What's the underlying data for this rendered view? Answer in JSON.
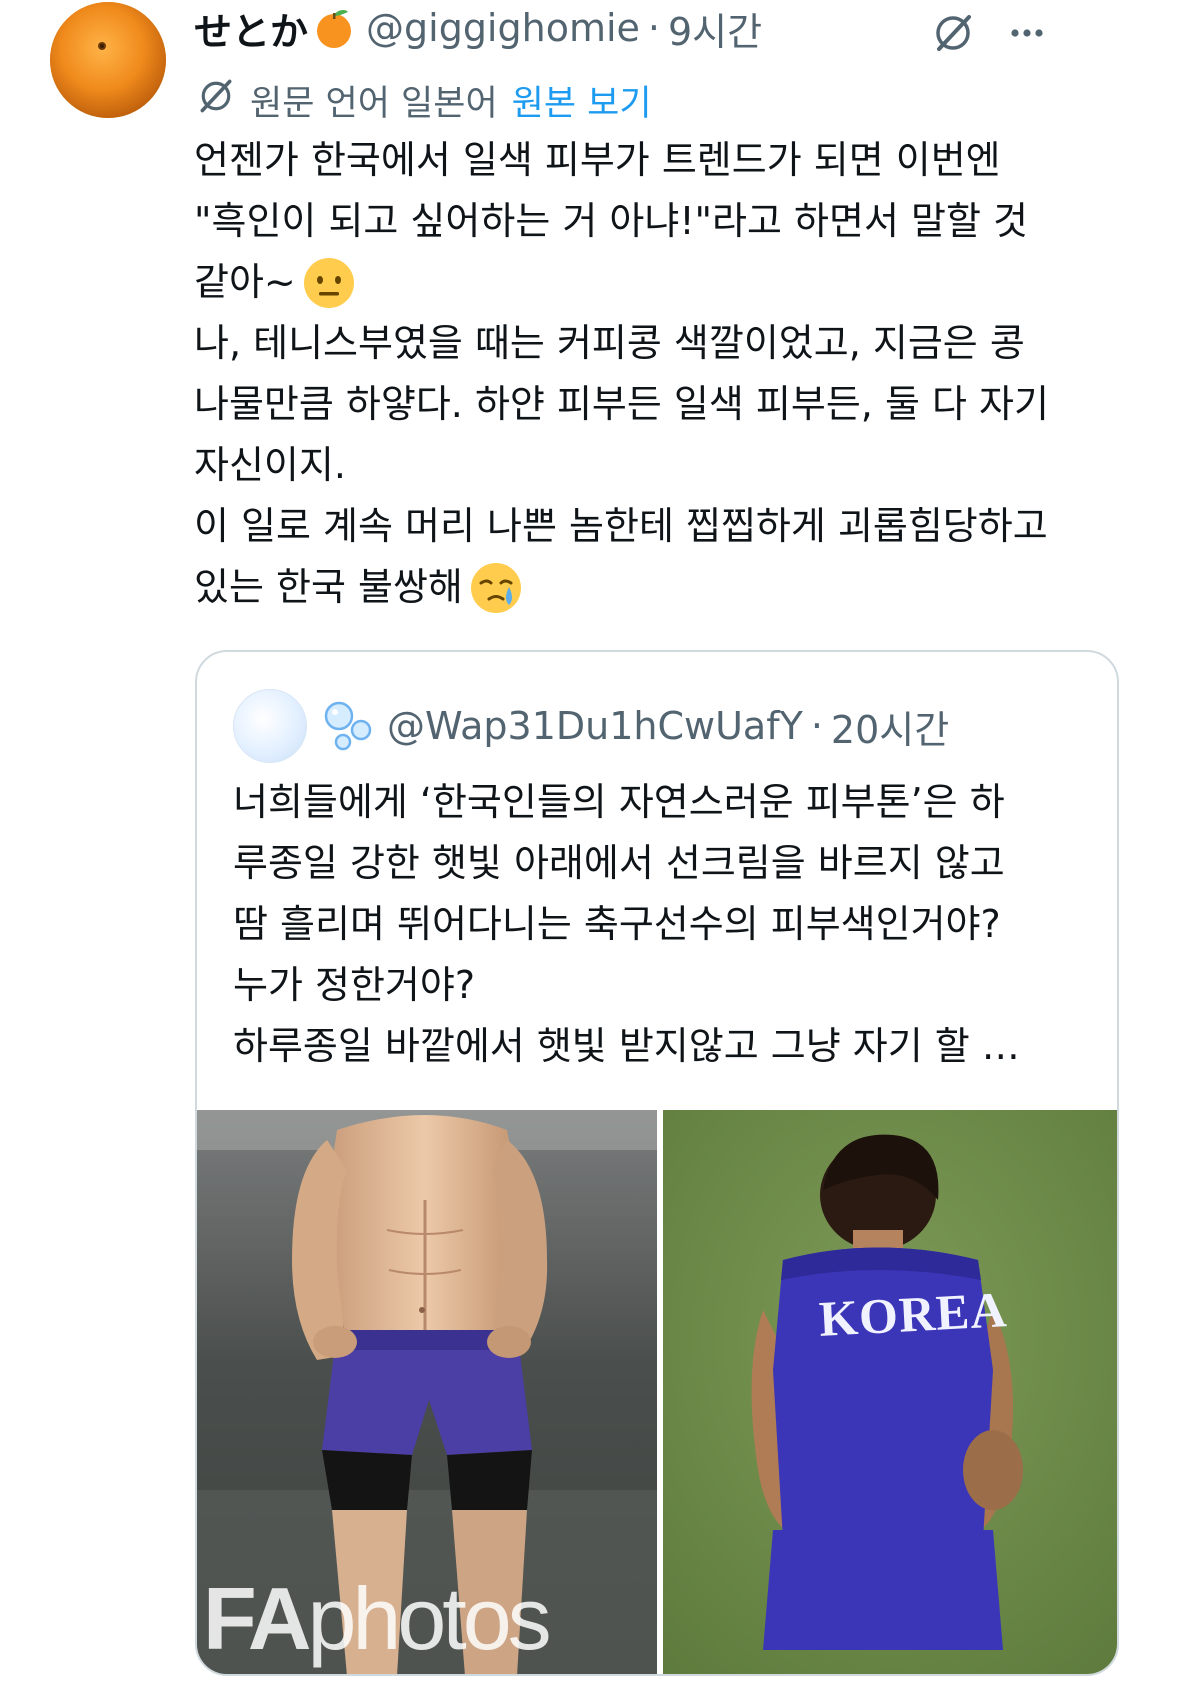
{
  "tweet": {
    "author": {
      "display_name": "せとか",
      "name_emoji": "tangerine-emoji",
      "handle": "@giggighomie",
      "time": "9시간",
      "avatar": "tangerine-photo"
    },
    "header_icons": [
      "grok-icon",
      "more-icon"
    ],
    "translation": {
      "icon": "grok-icon",
      "note": "원문 언어 일본어",
      "show_original_label": "원본 보기"
    },
    "body_lines": [
      "언젠가 한국에서 일색 피부가 트렌드가 되면 이번엔",
      "\"흑인이 되고 싶어하는 거 아냐!\"라고 하면서 말할 것",
      "같아~",
      "나, 테니스부였을 때는 커피콩 색깔이었고, 지금은 콩",
      "나물만큼 하얗다. 하얀 피부든 일색 피부든, 둘 다 자기",
      "자신이지.",
      "이 일로 계속 머리 나쁜 놈한테 찝찝하게 괴롭힘당하고",
      "있는 한국 불쌍해"
    ],
    "line_emojis": {
      "2": "neutral-face-emoji",
      "7": "crying-face-emoji"
    }
  },
  "quoted_tweet": {
    "avatar": "light-blue-circle",
    "name_emoji": "bubbles-emoji",
    "handle": "@Wap31Du1hCwUafY",
    "time": "20시간",
    "body_lines": [
      "너희들에게 ‘한국인들의 자연스러운 피부톤’은 하",
      "루종일 강한 햇빛 아래에서 선크림을 바르지 않고",
      "땀 흘리며 뛰어다니는 축구선수의 피부색인거야?",
      "누가 정한거야?",
      "하루종일 바깥에서 햇빛 받지않고 그냥 자기 할 …"
    ],
    "media": [
      {
        "description_icon": "shirtless-athlete-photo",
        "watermark_a": "FA",
        "watermark_b": "photos"
      },
      {
        "description_icon": "korea-jersey-player-photo",
        "jersey_text": "KOREA"
      }
    ]
  },
  "colors": {
    "text": "#0f1419",
    "secondary": "#536471",
    "link": "#1d9bf0",
    "border": "#cfd9de"
  }
}
